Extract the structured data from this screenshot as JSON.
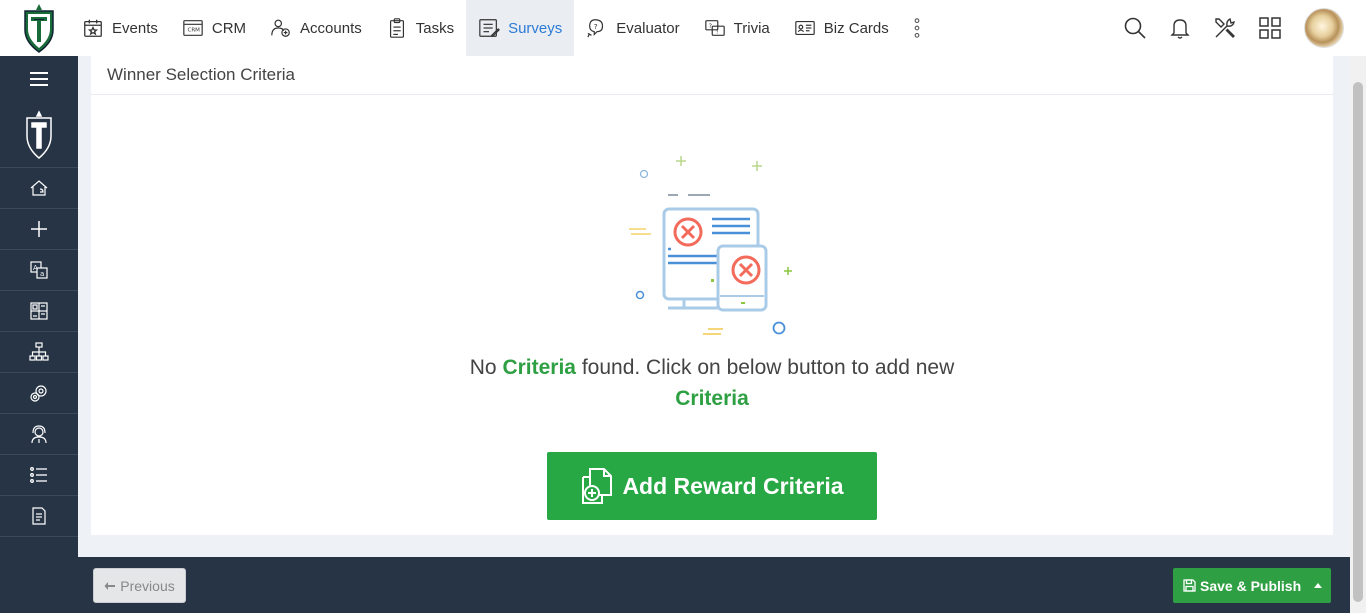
{
  "nav": {
    "items": [
      {
        "label": "Events",
        "icon": "calendar-star-icon"
      },
      {
        "label": "CRM",
        "icon": "crm-icon"
      },
      {
        "label": "Accounts",
        "icon": "accounts-icon"
      },
      {
        "label": "Tasks",
        "icon": "clipboard-icon"
      },
      {
        "label": "Surveys",
        "icon": "survey-icon",
        "active": true
      },
      {
        "label": "Evaluator",
        "icon": "evaluator-icon"
      },
      {
        "label": "Trivia",
        "icon": "trivia-icon"
      },
      {
        "label": "Biz Cards",
        "icon": "biz-card-icon"
      }
    ]
  },
  "card": {
    "header": "Winner Selection Criteria",
    "empty_prefix": "No ",
    "empty_highlight1": "Criteria",
    "empty_middle": " found. Click on below button to add new",
    "empty_highlight2": "Criteria",
    "add_button": "Add Reward Criteria"
  },
  "footer": {
    "previous": "Previous",
    "publish": "Save & Publish"
  },
  "colors": {
    "accent_green": "#28a745",
    "nav_active": "#2c7bd6",
    "sidebar_bg": "#263445"
  }
}
